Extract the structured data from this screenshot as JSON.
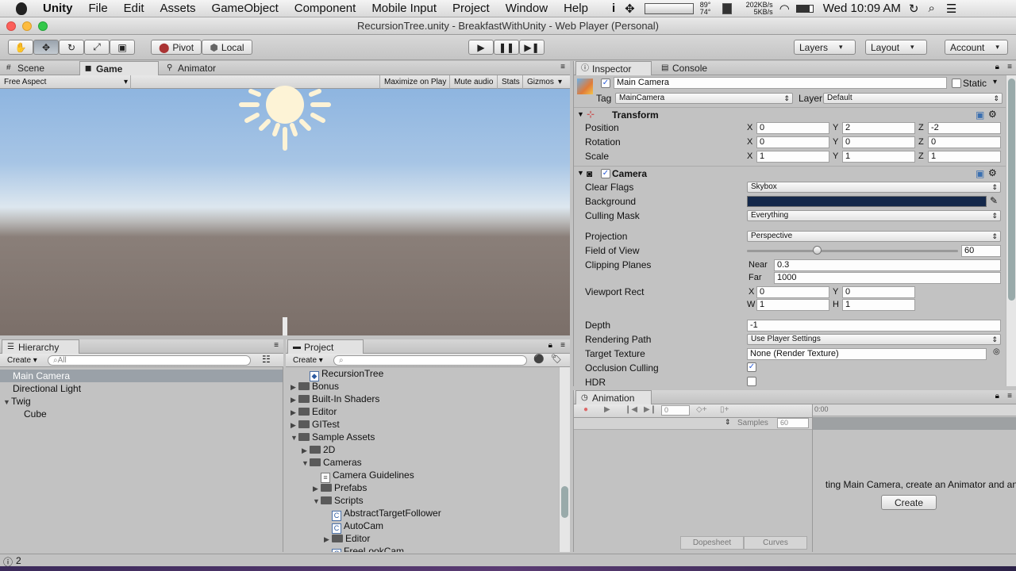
{
  "mac_menu": {
    "app": "Unity",
    "items": [
      "File",
      "Edit",
      "Assets",
      "GameObject",
      "Component",
      "Mobile Input",
      "Project",
      "Window",
      "Help"
    ],
    "temps": "89° 74°",
    "net": "202KB/s 5KB/s",
    "clock": "Wed 10:09 AM"
  },
  "window": {
    "title": "RecursionTree.unity - BreakfastWithUnity - Web Player (Personal)"
  },
  "toolbar": {
    "pivot": "Pivot",
    "local": "Local",
    "layers": "Layers",
    "layout": "Layout",
    "account": "Account"
  },
  "scene_tabs": {
    "scene": "Scene",
    "game": "Game",
    "animator": "Animator"
  },
  "game_bar": {
    "aspect": "Free Aspect",
    "maximize": "Maximize on Play",
    "mute": "Mute audio",
    "stats": "Stats",
    "gizmos": "Gizmos"
  },
  "hierarchy": {
    "title": "Hierarchy",
    "create": "Create",
    "search": "All",
    "items": [
      "Main Camera",
      "Directional Light",
      "Twig",
      "Cube"
    ]
  },
  "project": {
    "title": "Project",
    "create": "Create",
    "items": [
      {
        "label": "RecursionTree",
        "kind": "scene"
      },
      {
        "label": "Bonus",
        "kind": "folder"
      },
      {
        "label": "Built-In Shaders",
        "kind": "folder"
      },
      {
        "label": "Editor",
        "kind": "folder"
      },
      {
        "label": "GITest",
        "kind": "folder"
      },
      {
        "label": "Sample Assets",
        "kind": "folder"
      },
      {
        "label": "2D",
        "kind": "folder"
      },
      {
        "label": "Cameras",
        "kind": "folder"
      },
      {
        "label": "Camera Guidelines",
        "kind": "doc"
      },
      {
        "label": "Prefabs",
        "kind": "folder"
      },
      {
        "label": "Scripts",
        "kind": "folder"
      },
      {
        "label": "AbstractTargetFollower",
        "kind": "script"
      },
      {
        "label": "AutoCam",
        "kind": "script"
      },
      {
        "label": "Editor",
        "kind": "folder"
      },
      {
        "label": "FreeLookCam",
        "kind": "script"
      }
    ]
  },
  "inspector": {
    "tab": "Inspector",
    "console": "Console",
    "object_name": "Main Camera",
    "static": "Static",
    "tag_label": "Tag",
    "tag": "MainCamera",
    "layer_label": "Layer",
    "layer": "Default",
    "transform": {
      "title": "Transform",
      "position": "Position",
      "rotation": "Rotation",
      "scale": "Scale",
      "pos": [
        "0",
        "2",
        "-2"
      ],
      "rot": [
        "0",
        "0",
        "0"
      ],
      "scl": [
        "1",
        "1",
        "1"
      ]
    },
    "camera": {
      "title": "Camera",
      "clear_flags": "Clear Flags",
      "clear_flags_v": "Skybox",
      "background": "Background",
      "culling": "Culling Mask",
      "culling_v": "Everything",
      "projection": "Projection",
      "projection_v": "Perspective",
      "fov": "Field of View",
      "fov_v": "60",
      "clipping": "Clipping Planes",
      "near": "Near",
      "near_v": "0.3",
      "far": "Far",
      "far_v": "1000",
      "viewport": "Viewport Rect",
      "vx": "0",
      "vy": "0",
      "vw": "1",
      "vh": "1",
      "depth": "Depth",
      "depth_v": "-1",
      "rendering": "Rendering Path",
      "rendering_v": "Use Player Settings",
      "target": "Target Texture",
      "target_v": "None (Render Texture)",
      "occlusion": "Occlusion Culling",
      "hdr": "HDR"
    }
  },
  "animation": {
    "title": "Animation",
    "frame": "0",
    "samples": "Samples",
    "samples_v": "60",
    "time": "0:00",
    "message": "ting Main Camera, create an Animator and an",
    "create": "Create",
    "dopesheet": "Dopesheet",
    "curves": "Curves"
  },
  "status": {
    "count": "2"
  },
  "axes": {
    "x": "X",
    "y": "Y",
    "z": "Z",
    "w": "W",
    "h": "H"
  },
  "colors": {
    "camera_background": "#14284a",
    "sky_top": "#8eb5e0",
    "ground": "#7b6f69"
  }
}
